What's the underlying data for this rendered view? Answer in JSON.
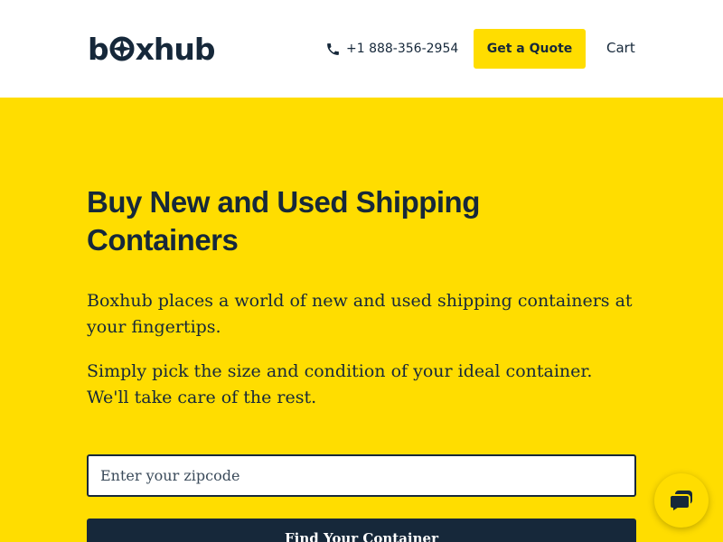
{
  "header": {
    "logo_text_left": "b",
    "logo_text_right": "xhub",
    "logo_name": "boxhub",
    "phone_number": "+1 888-356-2954",
    "quote_button": "Get a Quote",
    "cart_label": "Cart"
  },
  "hero": {
    "title": "Buy New and Used Shipping Containers",
    "paragraph1": "Boxhub places a world of new and used shipping containers at your fingertips.",
    "paragraph2": "Simply pick the size and condition of your ideal container. We'll take care of the rest.",
    "zip_placeholder": "Enter your zipcode",
    "find_button": "Find Your Container"
  },
  "colors": {
    "brand_yellow": "#ffdd00",
    "brand_navy": "#16283a",
    "header_bg": "#ffffff"
  },
  "icons": {
    "phone": "phone-icon",
    "chat": "chat-icon",
    "logo_mark": "boxhub-logo-mark"
  }
}
